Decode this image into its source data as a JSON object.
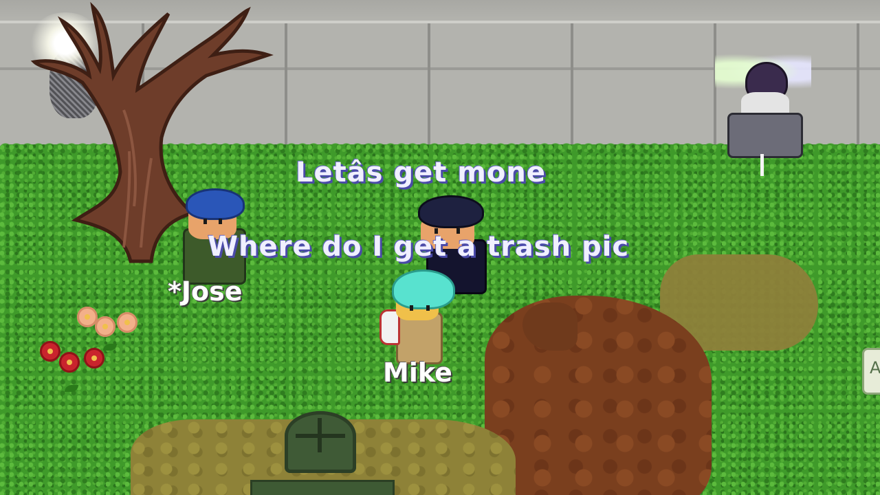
{
  "chat": {
    "line1": "Letâs get mone",
    "line2": "Where do I get a trash pic"
  },
  "players": {
    "jose": "*Jose",
    "mike": "Mike"
  },
  "edge_tab_glyph": "A",
  "icons": [
    "tree",
    "lamp",
    "flower-red",
    "flower-pink",
    "well",
    "bench"
  ],
  "colors": {
    "grass": "#3f9a2a",
    "wall": "#b3b3ae",
    "mud": "#7a3f1e",
    "dirt": "#8e8238",
    "chat_text": "#f0f0ff",
    "name_text": "#ffffff"
  }
}
